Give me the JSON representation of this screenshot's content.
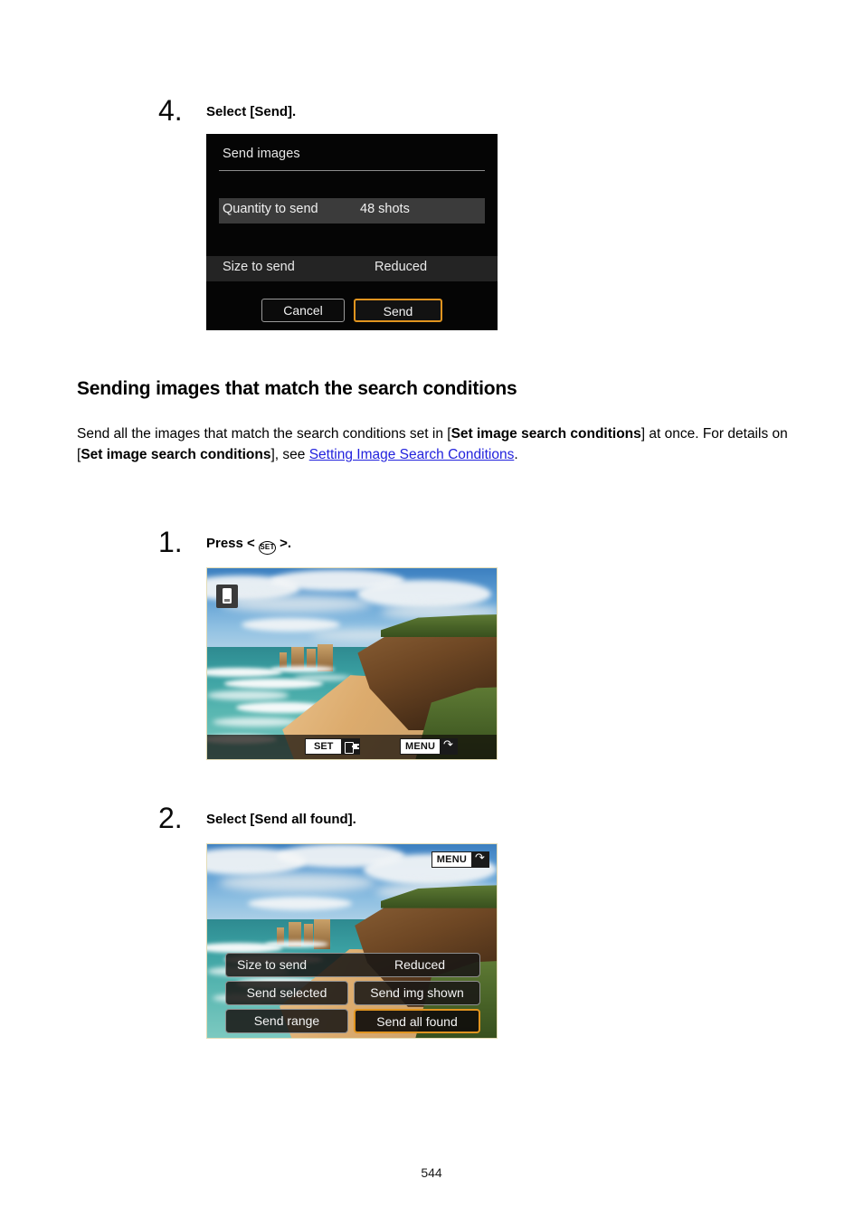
{
  "document": {
    "page_number": "544"
  },
  "steps": [
    {
      "number": "4.",
      "title": "Select [Send].",
      "screen": {
        "kind": "menu",
        "title": "Send images",
        "quantity_label": "Quantity to send",
        "quantity_value": "48 shots",
        "size_label": "Size to send",
        "size_value": "Reduced",
        "cancel_label": "Cancel",
        "send_label": "Send"
      }
    },
    {
      "number": "1.",
      "title_prefix": "Press <",
      "title_glyph": "SET",
      "title_suffix": ">.",
      "screen": {
        "kind": "photo-playback",
        "set_badge": "SET",
        "menu_badge": "MENU",
        "phone_icon": "smartphone-icon",
        "set_icon": "send-to-device-icon",
        "menu_icon": "return-arrow-icon"
      }
    },
    {
      "number": "2.",
      "title": "Select [Send all found].",
      "screen": {
        "kind": "photo-overlay-menu",
        "menu_badge": "MENU",
        "size_label": "Size to send",
        "size_value": "Reduced",
        "buttons": [
          "Send selected",
          "Send img shown",
          "Send range",
          "Send all found"
        ],
        "selected_button": "Send all found"
      }
    }
  ],
  "section": {
    "heading": "Sending images that match the search conditions",
    "paragraph": {
      "t1": "Send all the images that match the search conditions set in [",
      "b1": "Set image search conditions",
      "t2": "] at once. For details on [",
      "b2": "Set image search conditions",
      "t3": "], see ",
      "link": "Setting Image Search Conditions",
      "t4": "."
    }
  },
  "colors": {
    "highlight": "#e0941f",
    "link": "#2222dd",
    "screen_bg": "#050505"
  }
}
